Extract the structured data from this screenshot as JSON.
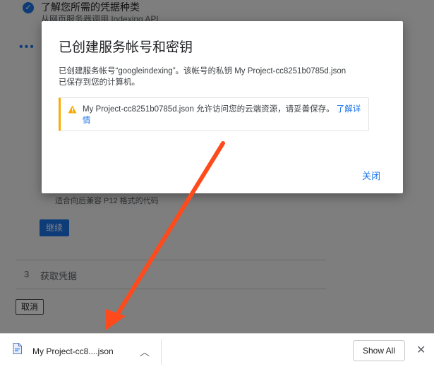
{
  "background": {
    "step_title": "了解您所需的凭据种类",
    "step_subtitle": "从网页服务器调用 Indexing API",
    "dots": "•••",
    "p12_text": "适合向后兼容 P12 格式的代码",
    "continue_label": "继续",
    "step3_number": "3",
    "step3_label": "获取凭据",
    "cancel_label": "取消"
  },
  "dialog": {
    "title": "已创建服务帐号和密钥",
    "body_line1": "已创建服务帐号“googleindexing”。该帐号的私钥 My Project-cc8251b0785d.json",
    "body_line2": "已保存到您的计算机。",
    "alert_text": "My Project-cc8251b0785d.json 允许访问您的云端资源，请妥善保存。",
    "alert_link": "了解详情",
    "close_label": "关闭"
  },
  "download_bar": {
    "file_name": "My Project-cc8....json",
    "show_all_label": "Show All",
    "close_glyph": "✕",
    "chevron_glyph": "︿"
  },
  "colors": {
    "accent": "#1a73e8",
    "warning": "#f9ab00",
    "arrow": "#ff4a1c"
  }
}
